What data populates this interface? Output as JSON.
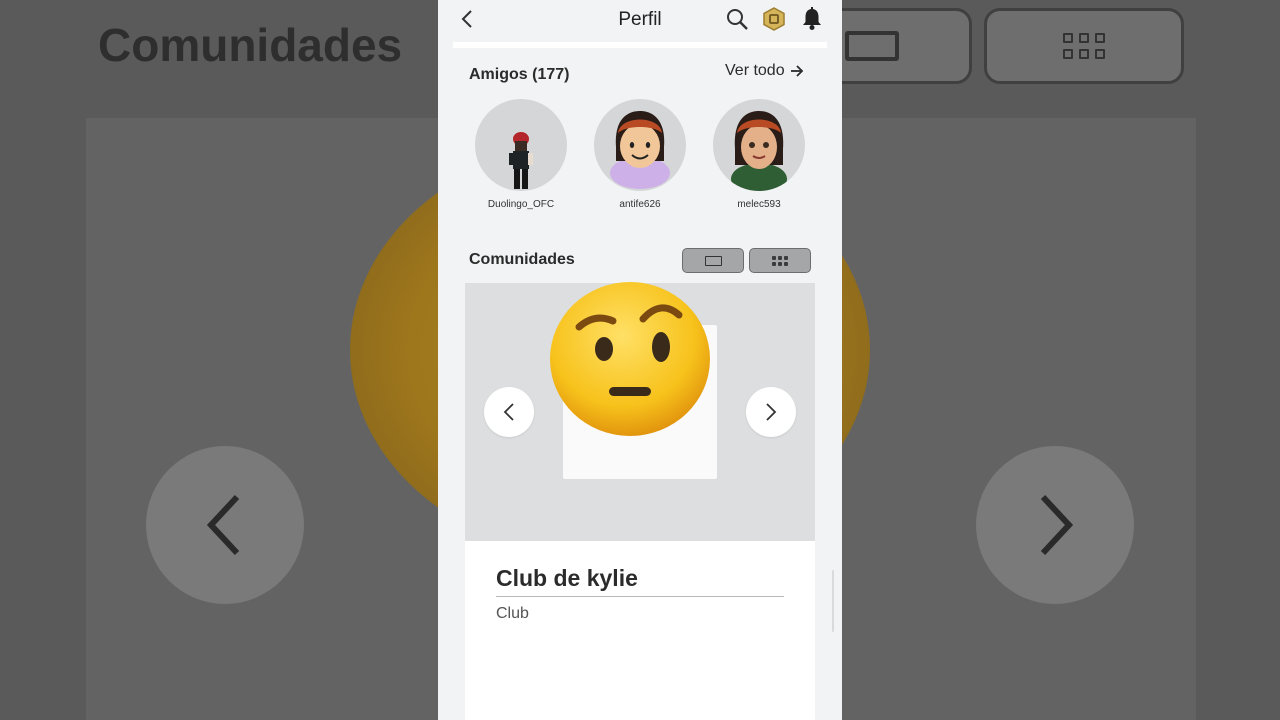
{
  "background": {
    "title": "Comunidades"
  },
  "header": {
    "title": "Perfil",
    "back_icon": "chevron-left-icon",
    "search_icon": "search-icon",
    "robux_icon": "robux-icon",
    "notification_icon": "bell-icon"
  },
  "friends": {
    "title": "Amigos",
    "count": "(177)",
    "see_all": "Ver todo",
    "items": [
      {
        "name": "Duolingo_OFC"
      },
      {
        "name": "antife626"
      },
      {
        "name": "melec593"
      }
    ]
  },
  "communities": {
    "title": "Comunidades",
    "view_single_icon": "single-view-icon",
    "view_grid_icon": "grid-view-icon",
    "prev_icon": "chevron-left-icon",
    "next_icon": "chevron-right-icon",
    "overlay_emoji": "raised-eyebrow-emoji",
    "card": {
      "name": "Club de kylie",
      "type": "Club"
    }
  },
  "colors": {
    "screen_bg": "#f1f3f4",
    "toggle_bg": "#a4a6a8",
    "emoji_yellow": "#f7c21b"
  }
}
